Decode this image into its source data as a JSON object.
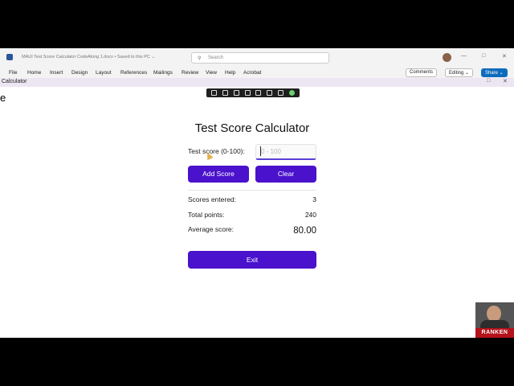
{
  "word": {
    "doc_title": "MAUI Test Score Calculator CodeAlong 1.docx • Saved to this PC ⌄",
    "search_placeholder": "Search",
    "tabs": [
      "File",
      "Home",
      "Insert",
      "Design",
      "Layout",
      "References",
      "Mailings",
      "Review",
      "View",
      "Help",
      "Acrobat"
    ],
    "comments_label": "Comments",
    "editing_label": "Editing ⌄",
    "share_label": "Share ⌄"
  },
  "app": {
    "window_title": "Calculator",
    "stray_text": "e"
  },
  "calculator": {
    "title": "Test Score Calculator",
    "input_label": "Test score (0-100):",
    "input_placeholder": "0 - 100",
    "input_value": "",
    "add_button": "Add Score",
    "clear_button": "Clear",
    "stats": {
      "entered_label": "Scores entered:",
      "entered_value": "3",
      "total_label": "Total points:",
      "total_value": "240",
      "average_label": "Average score:",
      "average_value": "80.00"
    },
    "exit_button": "Exit"
  },
  "presenter": {
    "brand": "RANKEN"
  },
  "colors": {
    "accent": "#4a12cc",
    "word_blue": "#2b579a",
    "title_bar": "#ece6f2"
  }
}
